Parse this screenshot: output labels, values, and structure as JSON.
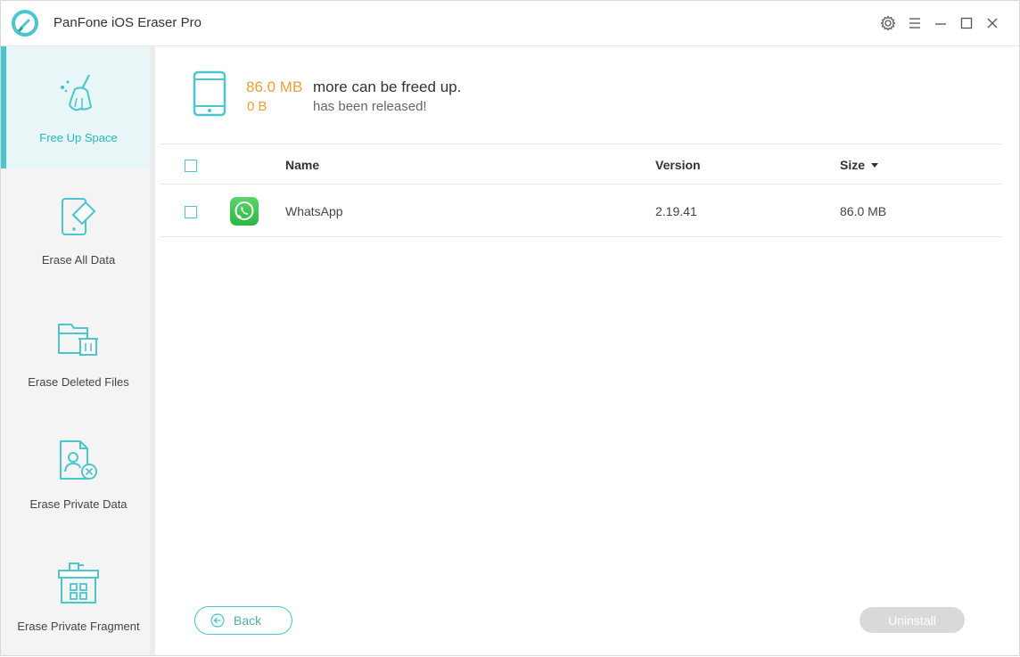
{
  "app": {
    "title": "PanFone iOS Eraser Pro"
  },
  "colors": {
    "accent": "#49c6d0",
    "highlight": "#f0a030",
    "disabled": "#d9d9d9"
  },
  "sidebar": {
    "items": [
      {
        "label": "Free Up Space",
        "icon": "broom-icon",
        "active": true
      },
      {
        "label": "Erase All Data",
        "icon": "phone-eraser-icon",
        "active": false
      },
      {
        "label": "Erase Deleted Files",
        "icon": "folder-trash-icon",
        "active": false
      },
      {
        "label": "Erase Private Data",
        "icon": "contact-delete-icon",
        "active": false
      },
      {
        "label": "Erase Private Fragment",
        "icon": "fragment-bin-icon",
        "active": false
      }
    ]
  },
  "summary": {
    "freeable_size": "86.0 MB",
    "freeable_text": "more can be freed up.",
    "released_size": "0 B",
    "released_text": "has been released!"
  },
  "table": {
    "columns": {
      "name": "Name",
      "version": "Version",
      "size": "Size"
    },
    "rows": [
      {
        "name": "WhatsApp",
        "version": "2.19.41",
        "size": "86.0 MB",
        "icon": "whatsapp-icon"
      }
    ]
  },
  "buttons": {
    "back": "Back",
    "uninstall": "Uninstall"
  }
}
